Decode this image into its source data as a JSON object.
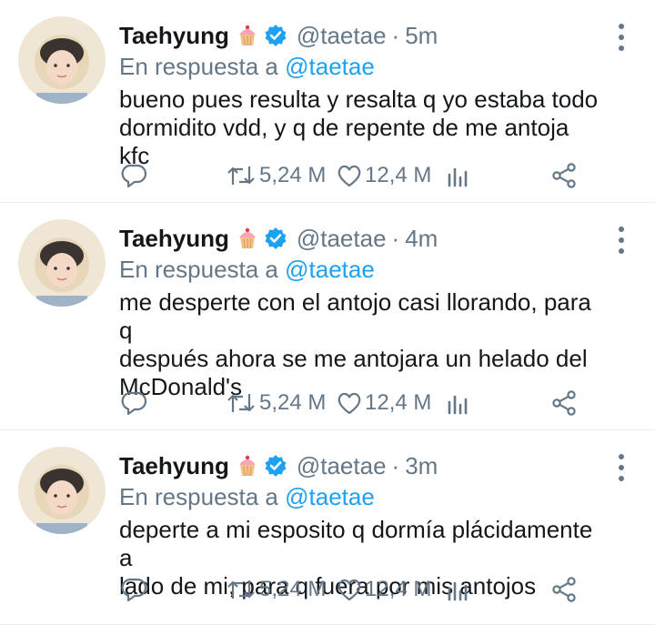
{
  "tweets": [
    {
      "name": "Taehyung",
      "handle": "@taetae",
      "dot": "·",
      "time": "5m",
      "reply_prefix": "En respuesta a",
      "reply_mention": "@taetae",
      "text": "bueno pues resulta y resalta q yo estaba todo\ndormidito vdd, y q de repente de me antoja kfc",
      "retweets": "5,24 M",
      "likes": "12,4 M"
    },
    {
      "name": "Taehyung",
      "handle": "@taetae",
      "dot": "·",
      "time": "4m",
      "reply_prefix": "En respuesta a",
      "reply_mention": "@taetae",
      "text": "me desperte con el antojo casi llorando, para q\ndespués ahora se me antojara un helado del\nMcDonald's",
      "retweets": "5,24 M",
      "likes": "12,4 M"
    },
    {
      "name": "Taehyung",
      "handle": "@taetae",
      "dot": "·",
      "time": "3m",
      "reply_prefix": "En respuesta a",
      "reply_mention": "@taetae",
      "text": "deperte a mi esposito q dormía plácidamente a\nlado de mi, para q fuera por mis antojos",
      "retweets": "5,24 M",
      "likes": "12,4 M"
    }
  ],
  "icons": {
    "name_emoji": "cupcake-icon",
    "verified": "verified-badge-icon",
    "more": "more-vertical-icon",
    "reply": "reply-icon",
    "retweet": "retweet-icon",
    "like": "heart-icon",
    "stats": "stats-icon",
    "share": "share-icon"
  },
  "colors": {
    "accent": "#1da1f2",
    "secondary_text": "#657786",
    "divider": "#e6ecf0"
  }
}
